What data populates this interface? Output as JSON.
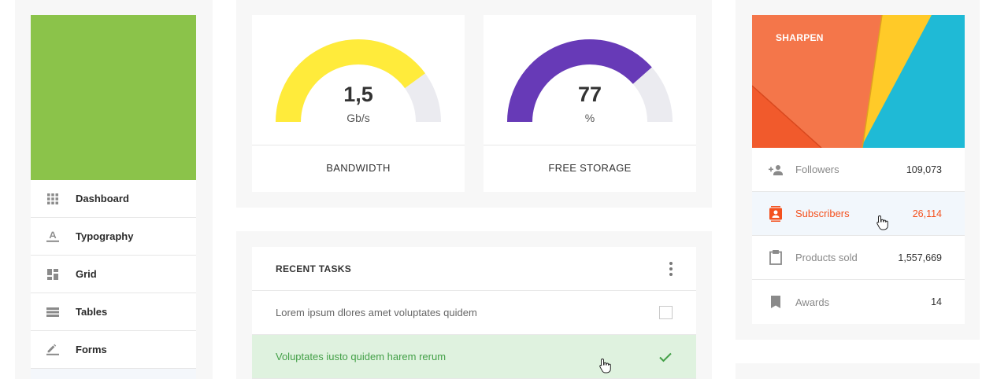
{
  "nav": {
    "items": [
      {
        "label": "Dashboard",
        "icon": "apps-grid-icon"
      },
      {
        "label": "Typography",
        "icon": "text-format-icon"
      },
      {
        "label": "Grid",
        "icon": "dashboard-layout-icon"
      },
      {
        "label": "Tables",
        "icon": "table-rows-icon"
      },
      {
        "label": "Forms",
        "icon": "pencil-icon"
      }
    ]
  },
  "gauges": [
    {
      "value": "1,5",
      "unit": "Gb/s",
      "label": "BANDWIDTH",
      "fill_fraction": 0.8,
      "color": "#ffeb3b"
    },
    {
      "value": "77",
      "unit": "%",
      "label": "FREE STORAGE",
      "fill_fraction": 0.77,
      "color": "#673ab7"
    }
  ],
  "tasks": {
    "title": "RECENT TASKS",
    "items": [
      {
        "text": "Lorem ipsum dlores amet voluptates quidem",
        "done": false
      },
      {
        "text": "Voluptates iusto quidem harem rerum",
        "done": true
      }
    ]
  },
  "social": {
    "banner_label": "SHARPEN",
    "stats": [
      {
        "label": "Followers",
        "value": "109,073",
        "icon": "people-add-icon"
      },
      {
        "label": "Subscribers",
        "value": "26,114",
        "icon": "contacts-icon",
        "active": true
      },
      {
        "label": "Products sold",
        "value": "1,557,669",
        "icon": "clipboard-icon"
      },
      {
        "label": "Awards",
        "value": "14",
        "icon": "bookmark-icon"
      }
    ]
  },
  "colors": {
    "green": "#8bc34a",
    "accent": "#f4511e",
    "yellow": "#ffeb3b",
    "purple": "#673ab7",
    "gauge_track": "#ebebf0",
    "done_bg": "#dff2df",
    "done_text": "#43a047"
  }
}
